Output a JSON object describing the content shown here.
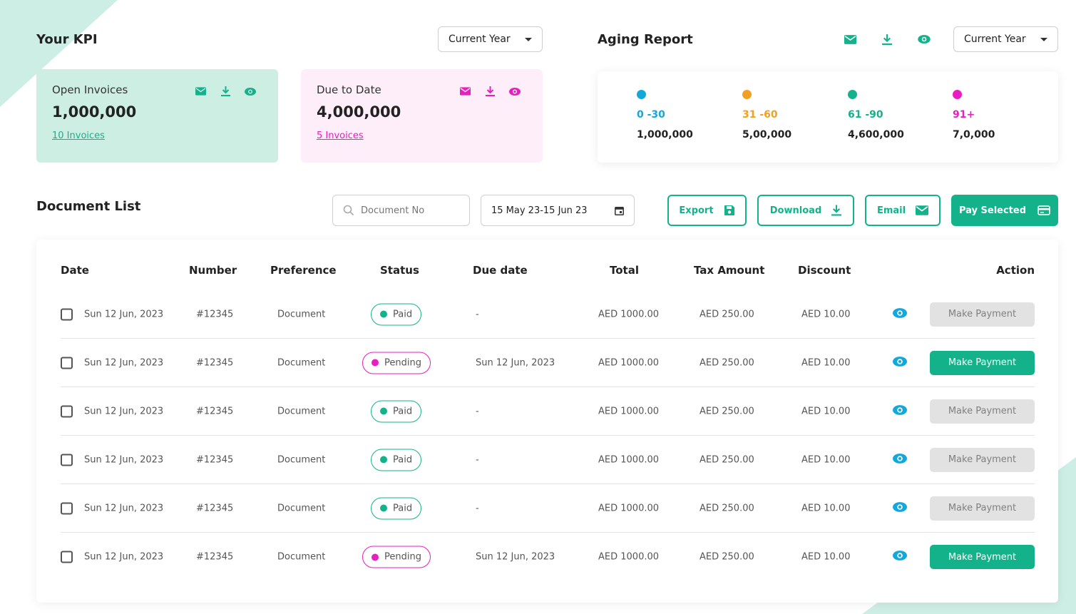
{
  "colors": {
    "accent": "#13b28b",
    "pink": "#e91ec0",
    "blue": "#12a8dc",
    "orange": "#f0a022",
    "kpi_green_bg": "#cdeee3",
    "kpi_pink_bg": "#fdeefa"
  },
  "kpi": {
    "title": "Your KPI",
    "period": "Current Year",
    "cards": [
      {
        "label": "Open Invoices",
        "value": "1,000,000",
        "link": "10 Invoices",
        "icons": [
          "mail-icon",
          "download-icon",
          "eye-icon"
        ]
      },
      {
        "label": "Due to Date",
        "value": "4,000,000",
        "link": "5 Invoices",
        "icons": [
          "mail-icon",
          "download-icon",
          "eye-icon"
        ]
      }
    ]
  },
  "aging": {
    "title": "Aging Report",
    "period": "Current Year",
    "icons": [
      "mail-icon",
      "download-icon",
      "eye-icon"
    ],
    "buckets": [
      {
        "range": "0 -30",
        "amount": "1,000,000",
        "color": "#12a8dc"
      },
      {
        "range": "31 -60",
        "amount": "5,00,000",
        "color": "#f0a022"
      },
      {
        "range": "61 -90",
        "amount": "4,600,000",
        "color": "#13b28b"
      },
      {
        "range": "91+",
        "amount": "7,0,000",
        "color": "#e91ec0"
      }
    ]
  },
  "documents": {
    "title": "Document List",
    "search_placeholder": "Document No",
    "date_range": "15 May 23-15 Jun 23",
    "buttons": {
      "export": "Export",
      "download": "Download",
      "email": "Email",
      "pay_selected": "Pay Selected"
    },
    "columns": [
      "Date",
      "Number",
      "Preference",
      "Status",
      "Due date",
      "Total",
      "Tax Amount",
      "Discount",
      "Action"
    ],
    "rows": [
      {
        "date": "Sun 12 Jun, 2023",
        "number": "#12345",
        "preference": "Document",
        "status": "Paid",
        "due": "-",
        "total": "AED 1000.00",
        "tax": "AED 250.00",
        "discount": "AED 10.00",
        "action": "Make Payment",
        "payable": false
      },
      {
        "date": "Sun 12 Jun, 2023",
        "number": "#12345",
        "preference": "Document",
        "status": "Pending",
        "due": "Sun 12 Jun, 2023",
        "total": "AED 1000.00",
        "tax": "AED 250.00",
        "discount": "AED 10.00",
        "action": "Make Payment",
        "payable": true
      },
      {
        "date": "Sun 12 Jun, 2023",
        "number": "#12345",
        "preference": "Document",
        "status": "Paid",
        "due": "-",
        "total": "AED 1000.00",
        "tax": "AED 250.00",
        "discount": "AED 10.00",
        "action": "Make Payment",
        "payable": false
      },
      {
        "date": "Sun 12 Jun, 2023",
        "number": "#12345",
        "preference": "Document",
        "status": "Paid",
        "due": "-",
        "total": "AED 1000.00",
        "tax": "AED 250.00",
        "discount": "AED 10.00",
        "action": "Make Payment",
        "payable": false
      },
      {
        "date": "Sun 12 Jun, 2023",
        "number": "#12345",
        "preference": "Document",
        "status": "Paid",
        "due": "-",
        "total": "AED 1000.00",
        "tax": "AED 250.00",
        "discount": "AED 10.00",
        "action": "Make Payment",
        "payable": false
      },
      {
        "date": "Sun 12 Jun, 2023",
        "number": "#12345",
        "preference": "Document",
        "status": "Pending",
        "due": "Sun 12 Jun, 2023",
        "total": "AED 1000.00",
        "tax": "AED 250.00",
        "discount": "AED 10.00",
        "action": "Make Payment",
        "payable": true
      }
    ]
  }
}
